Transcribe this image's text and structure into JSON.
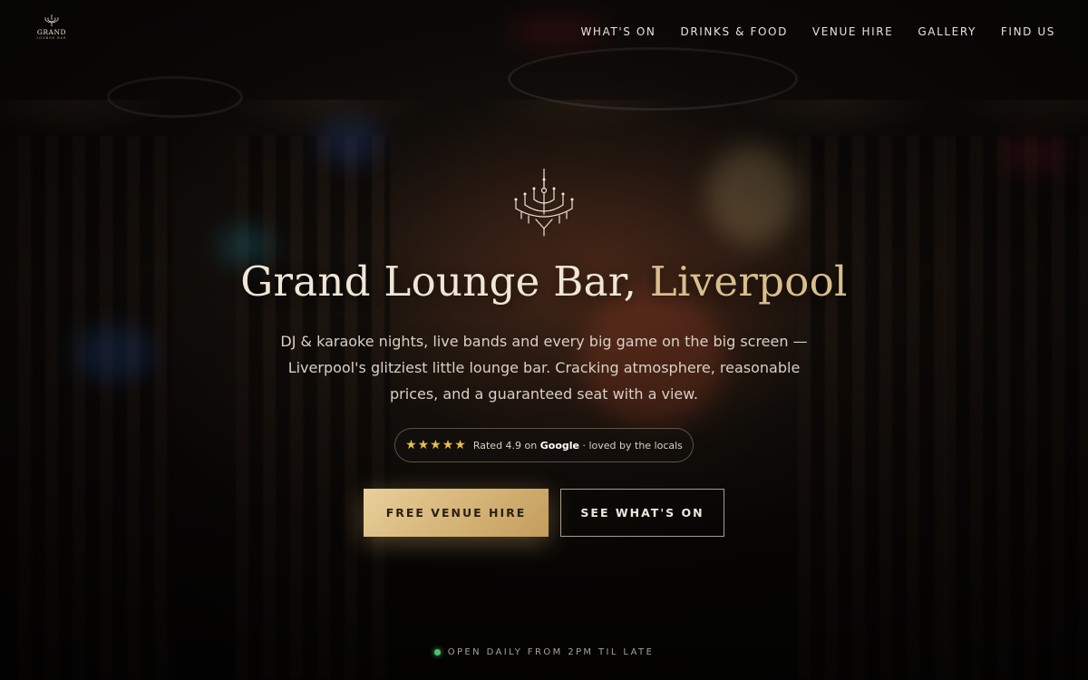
{
  "brand": {
    "logo_main": "GRAND",
    "logo_sub": "LOUNGE BAR"
  },
  "nav": {
    "items": [
      {
        "label": "WHAT'S ON"
      },
      {
        "label": "DRINKS & FOOD"
      },
      {
        "label": "VENUE HIRE"
      },
      {
        "label": "GALLERY"
      },
      {
        "label": "FIND US"
      }
    ]
  },
  "hero": {
    "icon": "chandelier-icon",
    "title_main": "Grand Lounge Bar, ",
    "title_accent": "Liverpool",
    "subtitle": "DJ & karaoke nights, live bands and every big game on the big screen — Liverpool's glitziest little lounge bar. Cracking atmosphere, reasonable prices, and a guaranteed seat with a view.",
    "rating": {
      "stars": "★★★★★",
      "prefix": "Rated 4.9 on ",
      "source": "Google",
      "suffix": " · loved by the locals"
    },
    "primary_cta": "FREE VENUE HIRE",
    "secondary_cta": "SEE WHAT'S ON"
  },
  "status": {
    "text": "OPEN DAILY FROM 2PM TIL LATE",
    "dot_color": "#4cc36a"
  },
  "colors": {
    "accent": "#d9be8c",
    "gold_button": "#d8b87c",
    "star": "#e8bd4a"
  }
}
